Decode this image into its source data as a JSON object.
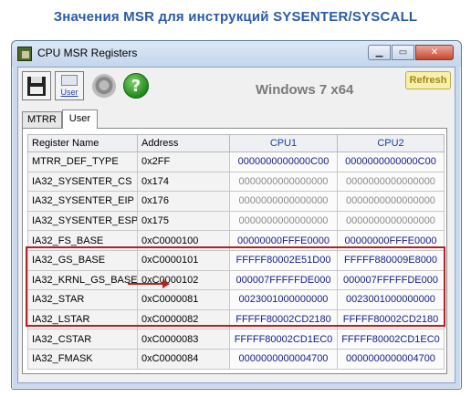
{
  "banner": {
    "title": "Значения MSR для инструкций SYSENTER/SYSCALL"
  },
  "window": {
    "title": "CPU MSR Registers",
    "caption_buttons": {
      "minimize": "▁",
      "maximize": "▭",
      "close": "✕"
    }
  },
  "toolbar": {
    "save_icon": "floppy-disk-icon",
    "user_icon": "user-icon",
    "user_label": "User",
    "wizard_icon": "wizard-icon",
    "help_icon": "help-icon",
    "help_glyph": "?"
  },
  "os_label": "Windows 7 x64",
  "refresh_label": "Refresh",
  "tabs": [
    {
      "label": "MTRR",
      "active": false
    },
    {
      "label": "User",
      "active": true
    }
  ],
  "grid": {
    "columns": [
      "Register Name",
      "Address",
      "CPU1",
      "CPU2"
    ],
    "rows": [
      {
        "name": "MTRR_DEF_TYPE",
        "address": "0x2FF",
        "cpu1": "0000000000000C00",
        "cpu2": "0000000000000C00",
        "grey": false
      },
      {
        "name": "IA32_SYSENTER_CS",
        "address": "0x174",
        "cpu1": "0000000000000000",
        "cpu2": "0000000000000000",
        "grey": true
      },
      {
        "name": "IA32_SYSENTER_EIP",
        "address": "0x176",
        "cpu1": "0000000000000000",
        "cpu2": "0000000000000000",
        "grey": true
      },
      {
        "name": "IA32_SYSENTER_ESP",
        "address": "0x175",
        "cpu1": "0000000000000000",
        "cpu2": "0000000000000000",
        "grey": true
      },
      {
        "name": "IA32_FS_BASE",
        "address": "0xC0000100",
        "cpu1": "00000000FFFE0000",
        "cpu2": "00000000FFFE0000",
        "grey": false
      },
      {
        "name": "IA32_GS_BASE",
        "address": "0xC0000101",
        "cpu1": "FFFFF80002E51D00",
        "cpu2": "FFFFF880009E8000",
        "grey": false
      },
      {
        "name": "IA32_KRNL_GS_BASE",
        "address": "0xC0000102",
        "cpu1": "000007FFFFFDE000",
        "cpu2": "000007FFFFFDE000",
        "grey": false
      },
      {
        "name": "IA32_STAR",
        "address": "0xC0000081",
        "cpu1": "0023001000000000",
        "cpu2": "0023001000000000",
        "grey": false
      },
      {
        "name": "IA32_LSTAR",
        "address": "0xC0000082",
        "cpu1": "FFFFF80002CD2180",
        "cpu2": "FFFFF80002CD2180",
        "grey": false
      },
      {
        "name": "IA32_CSTAR",
        "address": "0xC0000083",
        "cpu1": "FFFFF80002CD1EC0",
        "cpu2": "FFFFF80002CD1EC0",
        "grey": false
      },
      {
        "name": "IA32_FMASK",
        "address": "0xC0000084",
        "cpu1": "0000000000004700",
        "cpu2": "0000000000004700",
        "grey": false
      }
    ]
  },
  "colors": {
    "banner_title": "#2a5ba8",
    "highlight_box": "#b22222",
    "value_text": "#17208a",
    "value_text_muted": "#8a8a8a"
  }
}
